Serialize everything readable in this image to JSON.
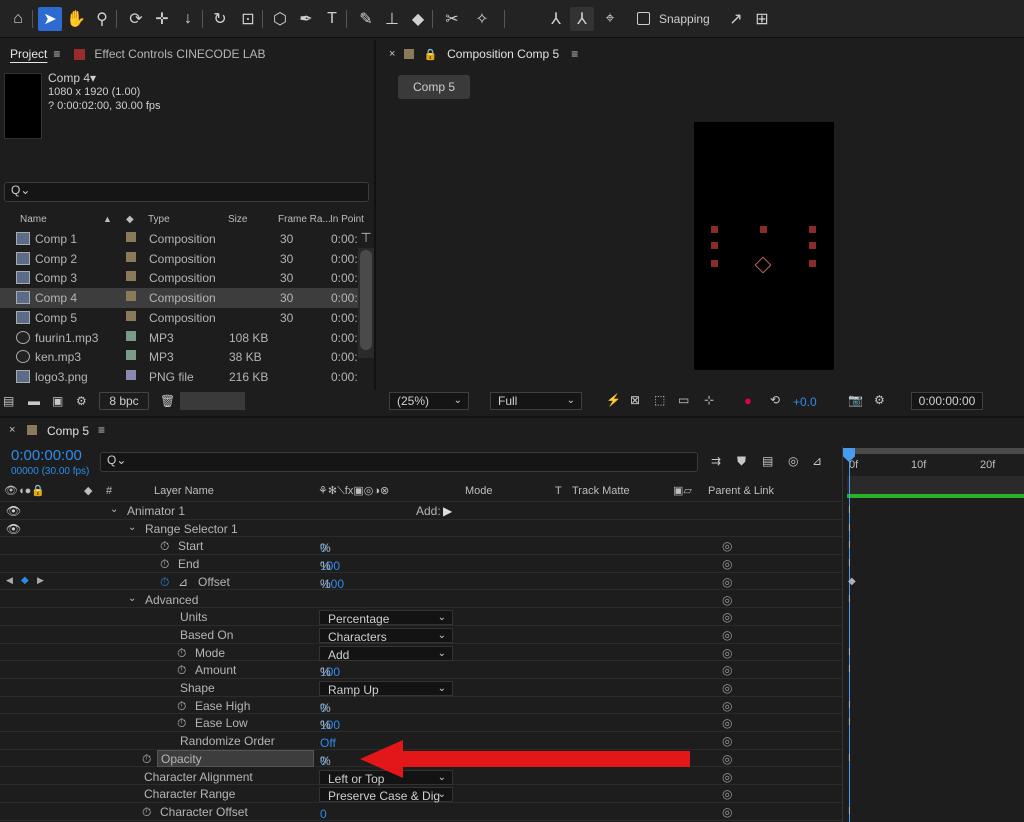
{
  "toolbar": {
    "icons": [
      "home-icon",
      "selection-icon",
      "hand-icon",
      "zoom-icon",
      "orbit-icon",
      "pan-icon",
      "dolly-icon",
      "rotate-icon",
      "anchor-icon",
      "shape-icon",
      "pen-icon",
      "type-icon",
      "brush-icon",
      "stamp-icon",
      "eraser-icon",
      "roto-icon",
      "puppet-icon",
      "axis-icon",
      "world-axis-icon",
      "view-axis-icon",
      "snap-icon"
    ],
    "snapping_label": "Snapping"
  },
  "project_panel": {
    "tab_project": "Project",
    "tab_effect_controls": "Effect Controls CINECODE LAB",
    "selected_name": "Comp 4▾",
    "selected_res": "1080 x 1920 (1.00)",
    "selected_duration": "? 0:00:02:00, 30.00 fps",
    "search_placeholder": "Q⌄",
    "columns": {
      "name": "Name",
      "type": "Type",
      "size": "Size",
      "frame_rate": "Frame Ra...",
      "in_point": "In Point"
    },
    "items": [
      {
        "name": "Comp 1",
        "type": "Composition",
        "size": "",
        "fps": "30",
        "in": "0:00:0",
        "color": "#8a7a5a",
        "kind": "comp"
      },
      {
        "name": "Comp 2",
        "type": "Composition",
        "size": "",
        "fps": "30",
        "in": "0:00:0",
        "color": "#8a7a5a",
        "kind": "comp"
      },
      {
        "name": "Comp 3",
        "type": "Composition",
        "size": "",
        "fps": "30",
        "in": "0:00:0",
        "color": "#8a7a5a",
        "kind": "comp"
      },
      {
        "name": "Comp 4",
        "type": "Composition",
        "size": "",
        "fps": "30",
        "in": "0:00:0",
        "color": "#8a7a5a",
        "kind": "comp"
      },
      {
        "name": "Comp 5",
        "type": "Composition",
        "size": "",
        "fps": "30",
        "in": "0:00:0",
        "color": "#8a7a5a",
        "kind": "comp"
      },
      {
        "name": "fuurin1.mp3",
        "type": "MP3",
        "size": "108 KB",
        "fps": "",
        "in": "0:00:0",
        "color": "#7a9a8a",
        "kind": "audio"
      },
      {
        "name": "ken.mp3",
        "type": "MP3",
        "size": "38 KB",
        "fps": "",
        "in": "0:00:0",
        "color": "#7a9a8a",
        "kind": "audio"
      },
      {
        "name": "logo3.png",
        "type": "PNG file",
        "size": "216 KB",
        "fps": "",
        "in": "0:00:0",
        "color": "#8a8ab0",
        "kind": "image"
      }
    ],
    "bpc": "8 bpc"
  },
  "composition_panel": {
    "tab_title": "Composition Comp 5",
    "breadcrumb": "Comp 5",
    "zoom": "(25%)",
    "resolution": "Full",
    "exposure": "+0.0",
    "timecode": "0:00:00:00"
  },
  "timeline": {
    "tab": "Comp 5",
    "current_time": "0:00:00:00",
    "frame_info": "00000 (30.00 fps)",
    "search_placeholder": "Q⌄",
    "col_layer_name": "Layer Name",
    "col_mode": "Mode",
    "col_t": "T",
    "col_track_matte": "Track Matte",
    "col_parent": "Parent & Link",
    "ruler": [
      "0f",
      "10f",
      "20f"
    ],
    "add_label": "Add:",
    "rows": [
      {
        "label": "Animator 1",
        "value": "",
        "indent": 1,
        "twirl": "down",
        "stopwatch": false,
        "eye": true
      },
      {
        "label": "Range Selector 1",
        "value": "",
        "indent": 2,
        "twirl": "down",
        "stopwatch": false,
        "eye": true
      },
      {
        "label": "Start",
        "value": "0",
        "unit": "%",
        "indent": 3,
        "stopwatch": true
      },
      {
        "label": "End",
        "value": "100",
        "unit": "%",
        "indent": 3,
        "stopwatch": true
      },
      {
        "label": "Offset",
        "value": "-100",
        "unit": "%",
        "indent": 3,
        "stopwatch": true,
        "keyed": true
      },
      {
        "label": "Advanced",
        "value": "",
        "indent": 2,
        "twirl": "down",
        "stopwatch": false
      },
      {
        "label": "Units",
        "dropdown": "Percentage",
        "indent": 4,
        "stopwatch": false
      },
      {
        "label": "Based On",
        "dropdown": "Characters",
        "indent": 4,
        "stopwatch": false
      },
      {
        "label": "Mode",
        "dropdown": "Add",
        "indent": 4,
        "stopwatch": true
      },
      {
        "label": "Amount",
        "value": "100",
        "unit": "%",
        "indent": 4,
        "stopwatch": true
      },
      {
        "label": "Shape",
        "dropdown": "Ramp Up",
        "indent": 4,
        "stopwatch": false
      },
      {
        "label": "Ease High",
        "value": "0",
        "unit": "%",
        "indent": 4,
        "stopwatch": true
      },
      {
        "label": "Ease Low",
        "value": "100",
        "unit": "%",
        "indent": 4,
        "stopwatch": true
      },
      {
        "label": "Randomize Order",
        "value": "Off",
        "unit": "",
        "indent": 4,
        "stopwatch": false
      },
      {
        "label": "Opacity",
        "value": "0",
        "unit": "%",
        "indent": 1,
        "stopwatch": true,
        "highlight": true
      },
      {
        "label": "Character Alignment",
        "dropdown": "Left or Top",
        "indent": 1,
        "stopwatch": false
      },
      {
        "label": "Character Range",
        "dropdown": "Preserve Case & Dig",
        "indent": 1,
        "stopwatch": false
      },
      {
        "label": "Character Offset",
        "value": "0",
        "unit": "",
        "indent": 1,
        "stopwatch": true
      }
    ]
  },
  "colors": {
    "accent": "#2d8ceb",
    "annotation_arrow": "#e3161a",
    "playhead": "#4a9bf0",
    "work_area": "#27b227"
  }
}
